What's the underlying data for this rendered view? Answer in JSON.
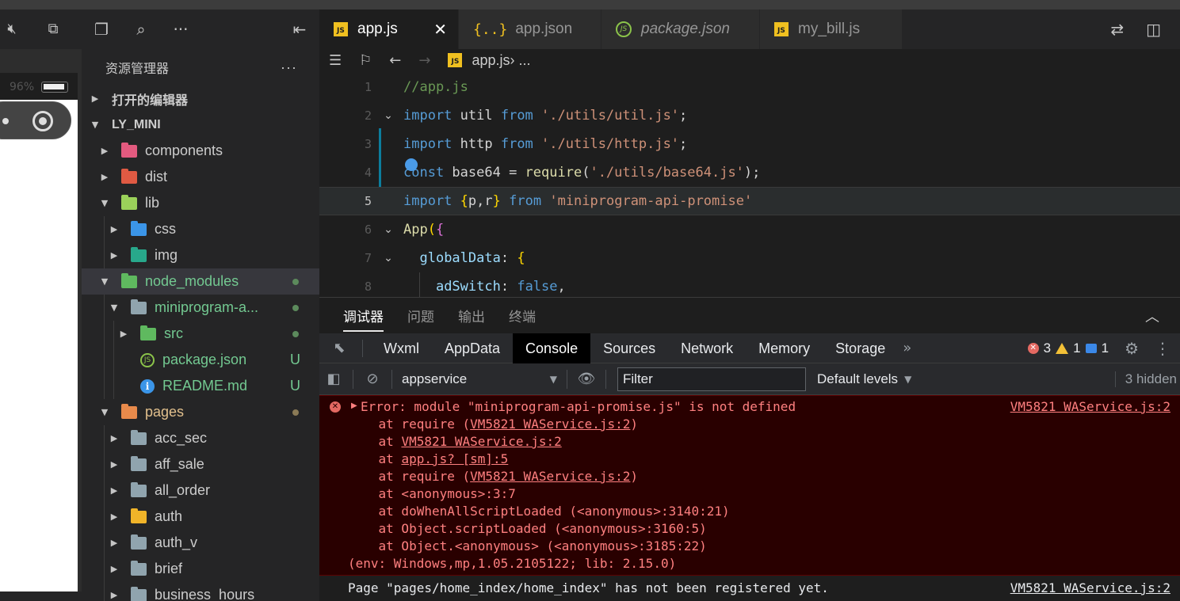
{
  "simulator": {
    "battery_percent": "96%",
    "icons": [
      "mute-icon",
      "window-icon"
    ]
  },
  "explorer": {
    "title": "资源管理器",
    "more": "···",
    "open_editors": "打开的编辑器",
    "project": "LY_MINI",
    "tree": [
      {
        "label": "components",
        "depth": 1,
        "chev": "▶",
        "color": "pink",
        "text_class": ""
      },
      {
        "label": "dist",
        "depth": 1,
        "chev": "▶",
        "color": "red",
        "text_class": ""
      },
      {
        "label": "lib",
        "depth": 1,
        "chev": "▼",
        "color": "lime",
        "text_class": ""
      },
      {
        "label": "css",
        "depth": 2,
        "chev": "▶",
        "color": "blue",
        "text_class": ""
      },
      {
        "label": "img",
        "depth": 2,
        "chev": "▶",
        "color": "teal",
        "text_class": ""
      },
      {
        "label": "node_modules",
        "depth": 1,
        "chev": "▼",
        "color": "green",
        "text_class": "green-text",
        "dot": "green",
        "selected": true
      },
      {
        "label": "miniprogram-a...",
        "depth": 2,
        "chev": "▼",
        "color": "gray",
        "text_class": "green-text",
        "dot": "green"
      },
      {
        "label": "src",
        "depth": 3,
        "chev": "▶",
        "color": "green",
        "text_class": "green-text",
        "dot": "green"
      },
      {
        "label": "package.json",
        "depth": 3,
        "chev": "",
        "icon": "nodejs",
        "text_class": "green-text",
        "status": "U"
      },
      {
        "label": "README.md",
        "depth": 3,
        "chev": "",
        "icon": "info",
        "text_class": "green-text",
        "status": "U"
      },
      {
        "label": "pages",
        "depth": 1,
        "chev": "▼",
        "color": "orange",
        "text_class": "ochre-text",
        "dot": "ochre"
      },
      {
        "label": "acc_sec",
        "depth": 2,
        "chev": "▶",
        "color": "gray",
        "text_class": ""
      },
      {
        "label": "aff_sale",
        "depth": 2,
        "chev": "▶",
        "color": "gray",
        "text_class": ""
      },
      {
        "label": "all_order",
        "depth": 2,
        "chev": "▶",
        "color": "gray",
        "text_class": ""
      },
      {
        "label": "auth",
        "depth": 2,
        "chev": "▶",
        "color": "yellow",
        "text_class": ""
      },
      {
        "label": "auth_v",
        "depth": 2,
        "chev": "▶",
        "color": "gray",
        "text_class": ""
      },
      {
        "label": "brief",
        "depth": 2,
        "chev": "▶",
        "color": "gray",
        "text_class": ""
      },
      {
        "label": "business_hours",
        "depth": 2,
        "chev": "▶",
        "color": "gray",
        "text_class": ""
      }
    ]
  },
  "tabs": [
    {
      "label": "app.js",
      "kind": "js",
      "active": true,
      "close": "✕"
    },
    {
      "label": "app.json",
      "kind": "json",
      "active": false
    },
    {
      "label": "package.json",
      "kind": "pkg",
      "active": false
    },
    {
      "label": "my_bill.js",
      "kind": "js",
      "active": false
    }
  ],
  "breadcrumb": {
    "file": "app.js",
    "rest": " › ..."
  },
  "editor": {
    "line_numbers": [
      "1",
      "2",
      "3",
      "4",
      "5",
      "6",
      "7",
      "8"
    ],
    "current_line": "5"
  },
  "debugger": {
    "tabs": [
      "调试器",
      "问题",
      "输出",
      "终端"
    ],
    "devtools_tabs": [
      "Wxml",
      "AppData",
      "Console",
      "Sources",
      "Network",
      "Memory",
      "Storage"
    ],
    "active_devtool": "Console",
    "error_count": "3",
    "warning_count": "1",
    "info_count": "1",
    "context": "appservice",
    "filter_placeholder": "Filter",
    "levels": "Default levels",
    "hidden": "3 hidden"
  },
  "console": {
    "error_message": "Error: module \"miniprogram-api-promise.js\" is not defined",
    "error_source": "VM5821 WAService.js:2",
    "stack": [
      {
        "prefix": "    at require (",
        "link": "VM5821 WAService.js:2",
        "suffix": ")"
      },
      {
        "prefix": "    at ",
        "link": "VM5821 WAService.js:2",
        "suffix": ""
      },
      {
        "prefix": "    at ",
        "link": "app.js? [sm]:5",
        "suffix": ""
      },
      {
        "prefix": "    at require (",
        "link": "VM5821 WAService.js:2",
        "suffix": ")"
      },
      {
        "prefix": "    at <anonymous>:3:7",
        "link": "",
        "suffix": ""
      },
      {
        "prefix": "    at doWhenAllScriptLoaded (<anonymous>:3140:21)",
        "link": "",
        "suffix": ""
      },
      {
        "prefix": "    at Object.scriptLoaded (<anonymous>:3160:5)",
        "link": "",
        "suffix": ""
      },
      {
        "prefix": "    at Object.<anonymous> (<anonymous>:3185:22)",
        "link": "",
        "suffix": ""
      }
    ],
    "env_line": "(env: Windows,mp,1.05.2105122; lib: 2.15.0)",
    "log_message": "Page \"pages/home_index/home_index\" has not been registered yet.",
    "log_source": "VM5821 WAService.js:2"
  }
}
